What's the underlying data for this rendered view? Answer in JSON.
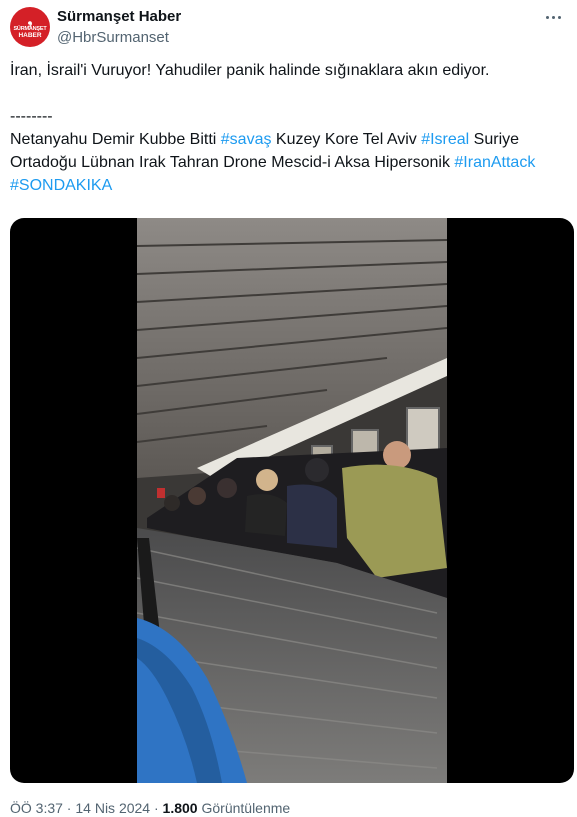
{
  "account": {
    "display_name": "Sürmanşet Haber",
    "handle": "@HbrSurmanset",
    "avatar_line1": "SÜRMANŞET",
    "avatar_line2": "HABER",
    "avatar_color": "#d42027"
  },
  "tweet": {
    "line1": "İran, İsrail'i Vuruyor! Yahudiler panik halinde sığınaklara akın ediyor.",
    "separator": "--------",
    "segments": [
      {
        "text": "Netanyahu Demir Kubbe Bitti ",
        "hashtag": false
      },
      {
        "text": "#savaş",
        "hashtag": true
      },
      {
        "text": " Kuzey Kore Tel Aviv ",
        "hashtag": false
      },
      {
        "text": "#Isreal",
        "hashtag": true
      },
      {
        "text": " Suriye Ortadoğu Lübnan Irak Tahran Drone Mescid-i Aksa Hipersonik ",
        "hashtag": false
      },
      {
        "text": "#IranAttack",
        "hashtag": true
      },
      {
        "text": " ",
        "hashtag": false
      },
      {
        "text": "#SONDAKIKA",
        "hashtag": true
      }
    ]
  },
  "meta": {
    "time": "ÖÖ 3:37",
    "dot1": " · ",
    "date": "14 Nis 2024",
    "dot2": " · ",
    "views_count": "1.800",
    "views_label": " Görüntülenme"
  },
  "colors": {
    "link": "#1d9bf0",
    "secondary_text": "#536471",
    "primary_text": "#0f1419"
  },
  "icons": {
    "more": "more-horizontal-icon"
  }
}
